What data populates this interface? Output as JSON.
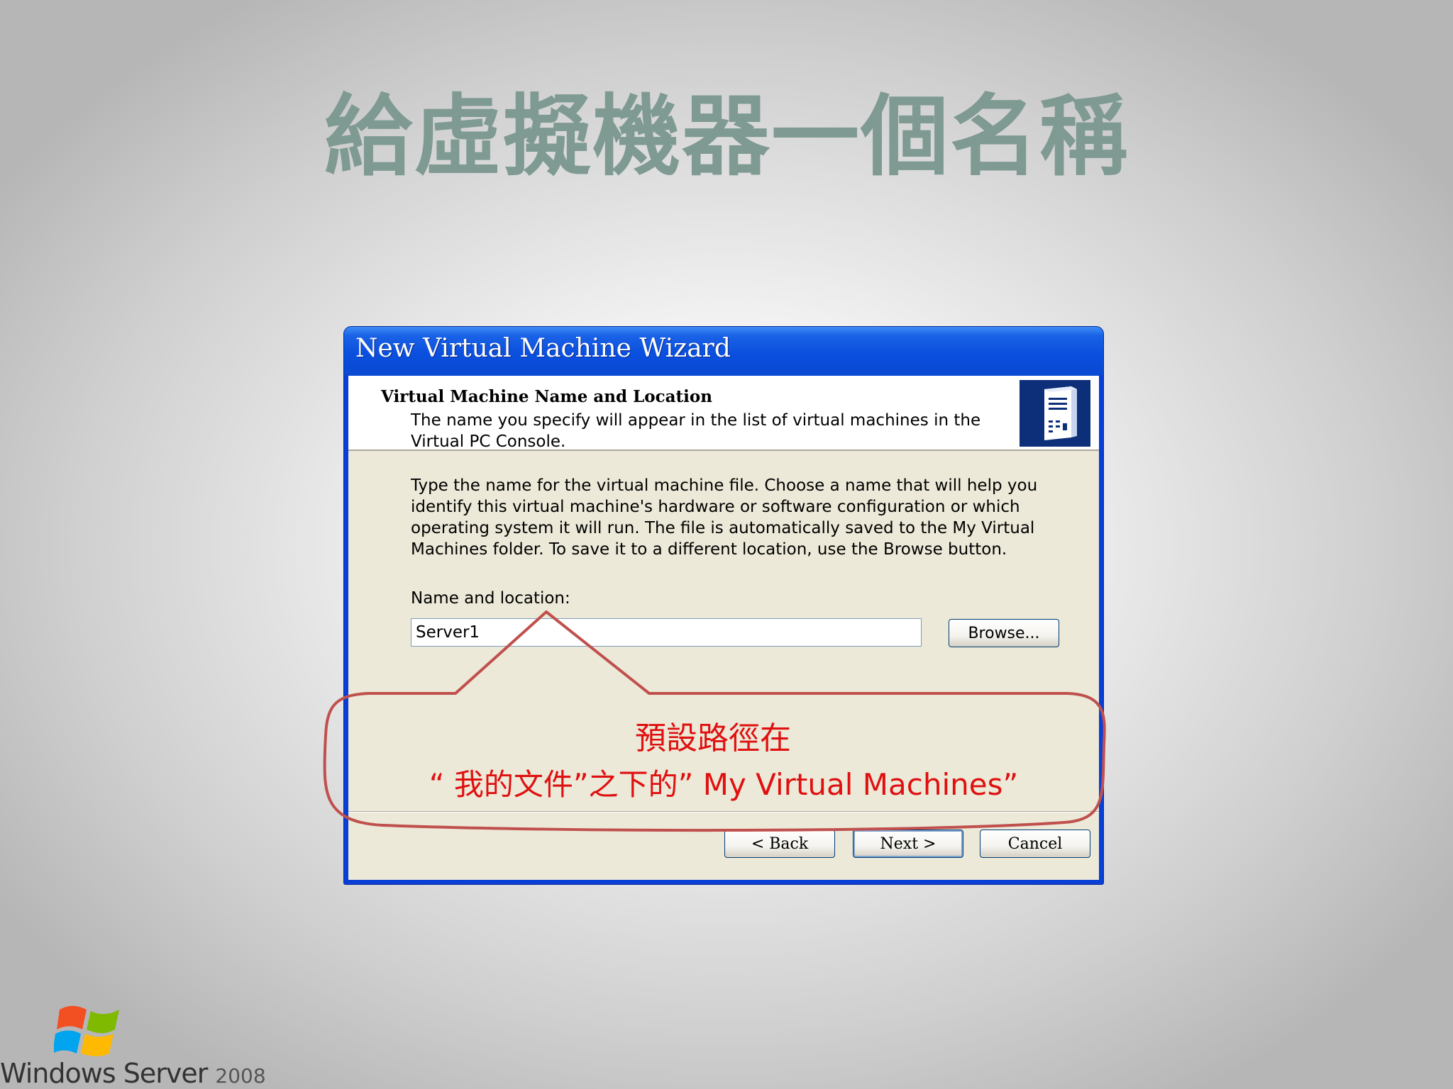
{
  "slide": {
    "title": "給虛擬機器一個名稱"
  },
  "wizard": {
    "window_title": "New Virtual Machine Wizard",
    "header_title": "Virtual Machine Name and Location",
    "header_subtitle": "The name you specify will appear in the list of virtual machines in the Virtual PC Console.",
    "header_icon": "server-tower-icon",
    "body_text": "Type the name for the virtual machine file. Choose a name that will help you identify this virtual machine's hardware or software configuration or which operating system it will run. The file is automatically saved to the My Virtual Machines folder. To save it to a different location, use the Browse button.",
    "field_label": "Name and location:",
    "name_value": "Server1",
    "browse_label": "Browse...",
    "back_label": "< Back",
    "next_label": "Next >",
    "cancel_label": "Cancel"
  },
  "callout": {
    "line1": "預設路徑在",
    "line2": "“ 我的文件”之下的”  My Virtual Machines”",
    "color": "#c0504d"
  },
  "brand": {
    "name": "Windows Server",
    "year": "2008",
    "logo_icon": "windows-flag-icon"
  },
  "colors": {
    "title_color": "#7e9a92",
    "xp_blue": "#0a4fde",
    "dialog_face": "#ece9d8",
    "callout_text": "#e01010"
  }
}
